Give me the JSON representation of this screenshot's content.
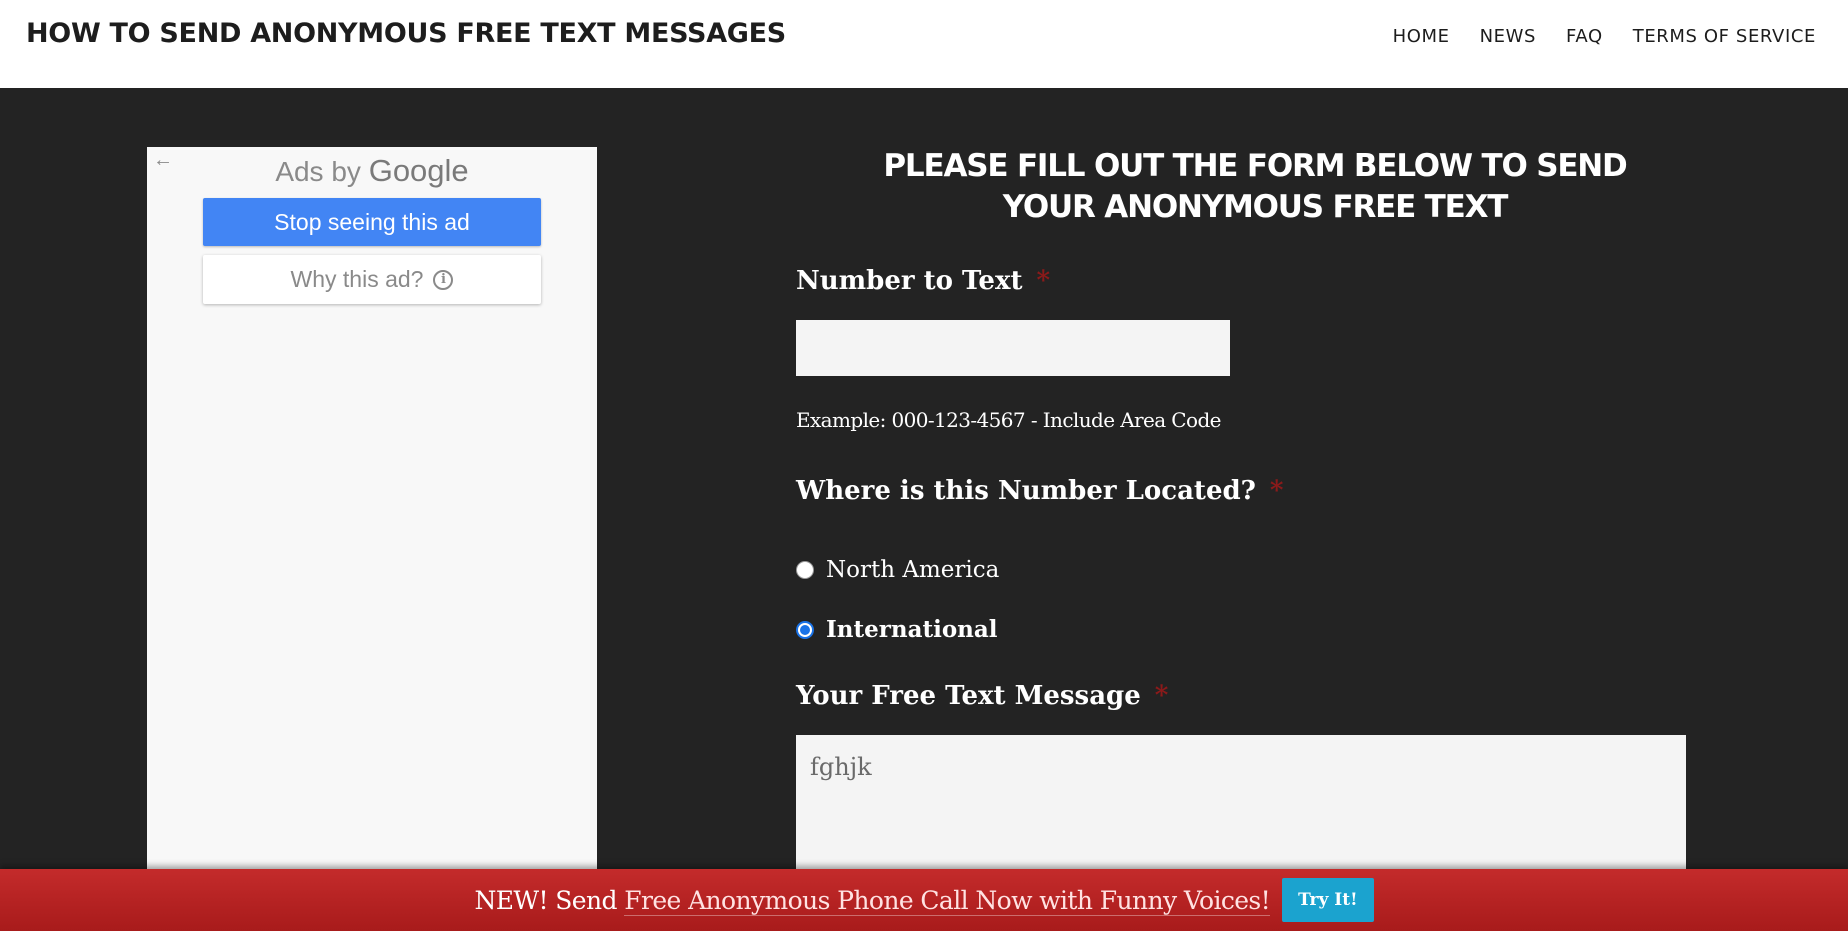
{
  "header": {
    "site_title": "HOW TO SEND ANONYMOUS FREE TEXT MESSAGES",
    "nav": [
      "HOME",
      "NEWS",
      "FAQ",
      "TERMS OF SERVICE"
    ]
  },
  "ad": {
    "back_icon": "arrow-left-icon",
    "ads_by_prefix": "Ads by",
    "ads_by_brand": "Google",
    "stop_label": "Stop seeing this ad",
    "why_label": "Why this ad?",
    "info_icon": "info-icon",
    "stop_color": "#4285f4"
  },
  "form": {
    "heading": "PLEASE FILL OUT THE FORM BELOW TO SEND YOUR ANONYMOUS FREE TEXT",
    "number_label": "Number to Text",
    "required_mark": "*",
    "number_value": "",
    "number_hint": "Example: 000-123-4567 - Include Area Code",
    "location_label": "Where is this Number Located?",
    "location_options": [
      {
        "label": "North America",
        "selected": false
      },
      {
        "label": "International",
        "selected": true
      }
    ],
    "message_label": "Your Free Text Message",
    "message_value": "fghjk"
  },
  "promo": {
    "new_label": "NEW!",
    "send_label": "Send",
    "highlight": "Free Anonymous Phone Call Now with Funny Voices!",
    "try_label": "Try It!",
    "bar_color": "#b82424",
    "button_color": "#1ba3cf"
  }
}
